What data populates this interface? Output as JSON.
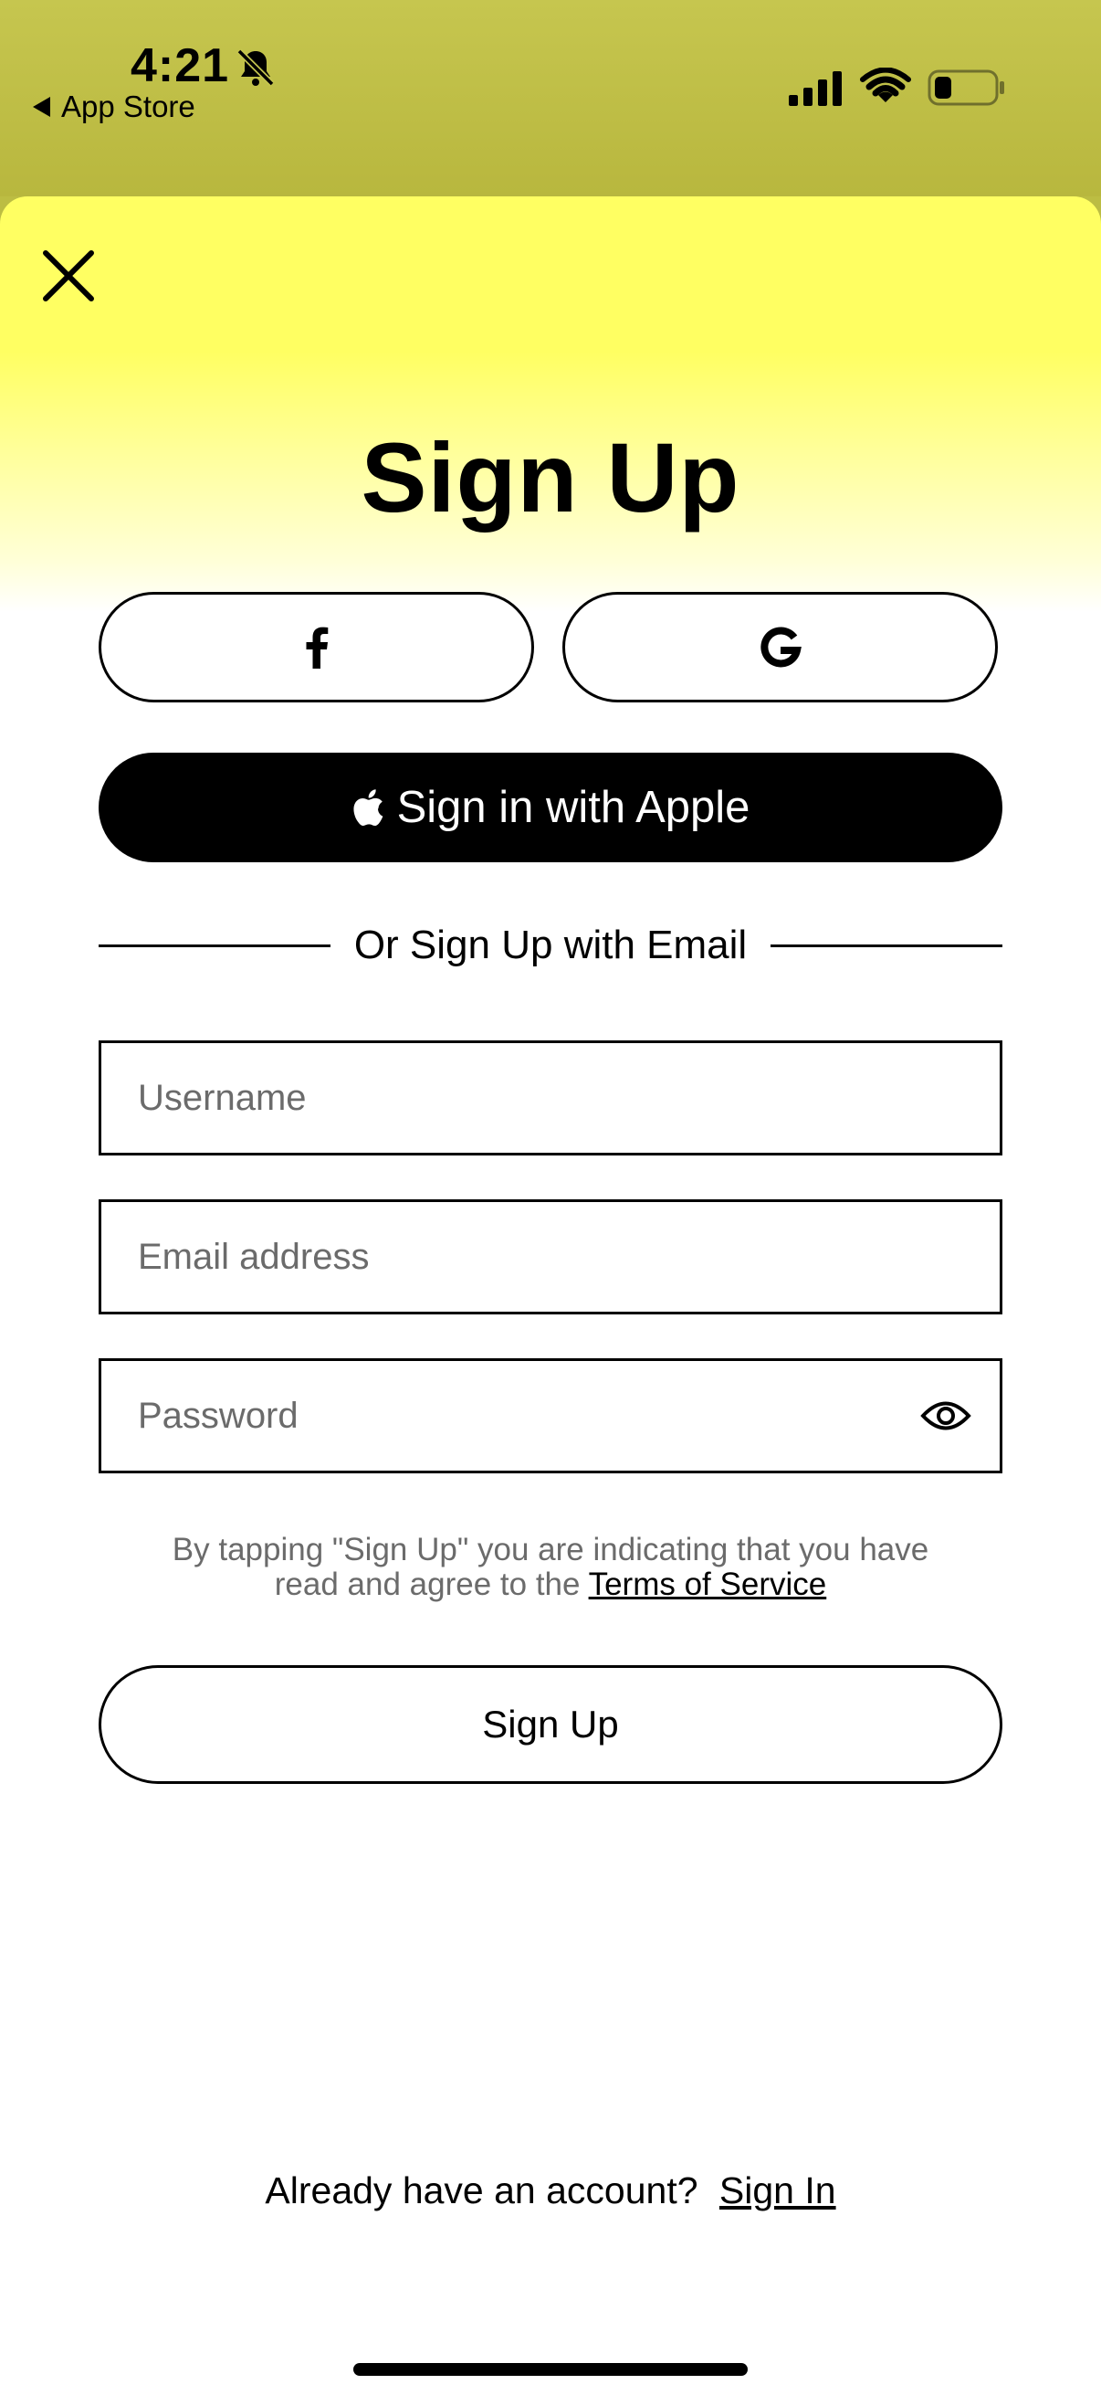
{
  "status_bar": {
    "time": "4:21",
    "back_label": "App Store",
    "icons": [
      "bell-slash-icon",
      "cellular-signal-icon",
      "wifi-icon",
      "battery-icon"
    ]
  },
  "sheet": {
    "close_icon": "close-icon",
    "title": "Sign Up",
    "social": {
      "facebook_icon": "facebook-icon",
      "google_icon": "google-icon"
    },
    "apple_button": {
      "icon": "apple-icon",
      "label": "Sign in with Apple"
    },
    "divider_label": "Or Sign Up with Email",
    "fields": {
      "username": {
        "placeholder": "Username",
        "value": ""
      },
      "email": {
        "placeholder": "Email address",
        "value": ""
      },
      "password": {
        "placeholder": "Password",
        "value": "",
        "toggle_icon": "eye-icon"
      }
    },
    "terms": {
      "line1": "By tapping \"Sign Up\" you are indicating that you have",
      "line2_prefix": "read and agree to the",
      "link": "Terms of Service"
    },
    "signup_button": "Sign Up",
    "footer": {
      "prompt": "Already have an account?",
      "link": "Sign In"
    }
  },
  "colors": {
    "header_bar": "#c2c24a",
    "sheet_top": "#ffff62",
    "background": "#ffffff",
    "text": "#000000",
    "muted_text": "#6b6b6b"
  }
}
